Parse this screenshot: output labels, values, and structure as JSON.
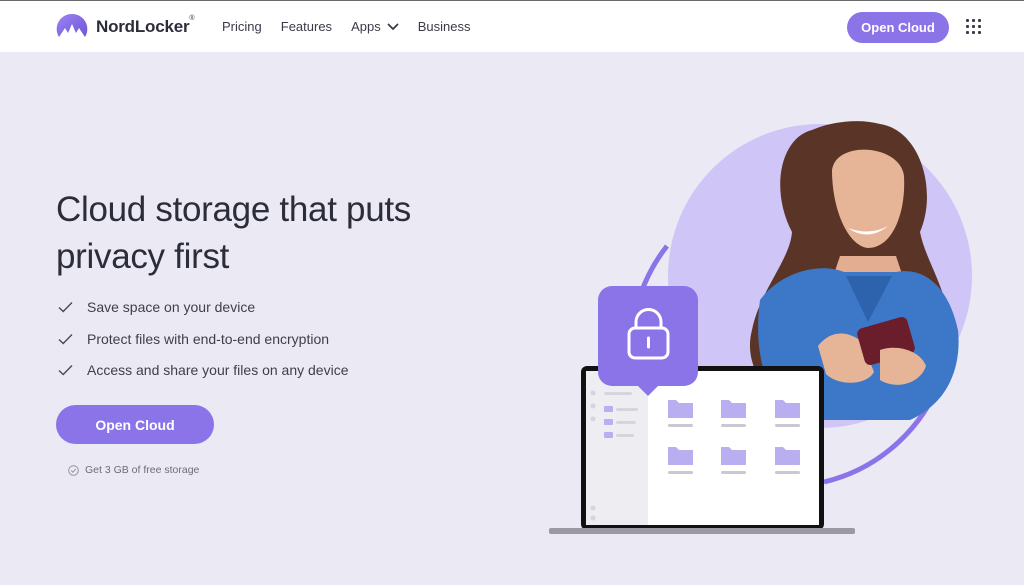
{
  "header": {
    "brand": "NordLocker",
    "brand_mark": "®",
    "nav": [
      {
        "label": "Pricing",
        "icon": null
      },
      {
        "label": "Features",
        "icon": null
      },
      {
        "label": "Apps",
        "icon": "chevron-down-icon"
      },
      {
        "label": "Business",
        "icon": null
      }
    ],
    "cta_label": "Open Cloud",
    "menu_icon": "apps-grid-icon"
  },
  "hero": {
    "title": "Cloud storage that puts privacy first",
    "features": [
      "Save space on your device",
      "Protect files with end-to-end encryption",
      "Access and share your files on any device"
    ],
    "cta_label": "Open Cloud",
    "note": "Get 3 GB of free storage"
  },
  "colors": {
    "accent": "#8a74e8",
    "background": "#ebe9f4",
    "text": "#2c2d3a",
    "circle": "#cfc6f7"
  }
}
